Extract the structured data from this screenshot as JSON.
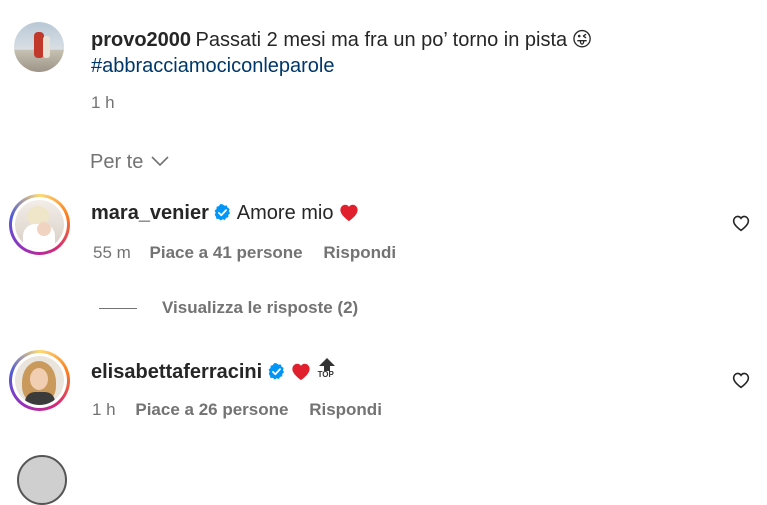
{
  "post": {
    "username": "provo2000",
    "caption": "Passati 2 mesi ma fra un po’ torno in pista",
    "emoji": "😜",
    "hashtag": "#abbracciamociconleparole",
    "time": "1 h"
  },
  "filter": {
    "label": "Per te"
  },
  "comments": [
    {
      "username": "mara_venier",
      "text": "Amore mio",
      "time": "55 m",
      "likes": "Piace a 41 persone",
      "reply": "Rispondi",
      "view_replies": "Visualizza le risposte (2)"
    },
    {
      "username": "elisabettaferracini",
      "text": "",
      "top_label": "TOP",
      "time": "1 h",
      "likes": "Piace a 26 persone",
      "reply": "Rispondi"
    }
  ],
  "colors": {
    "hashtag": "#00376b",
    "meta": "#737373",
    "heart": "#ed4956",
    "verified": "#0095f6"
  }
}
